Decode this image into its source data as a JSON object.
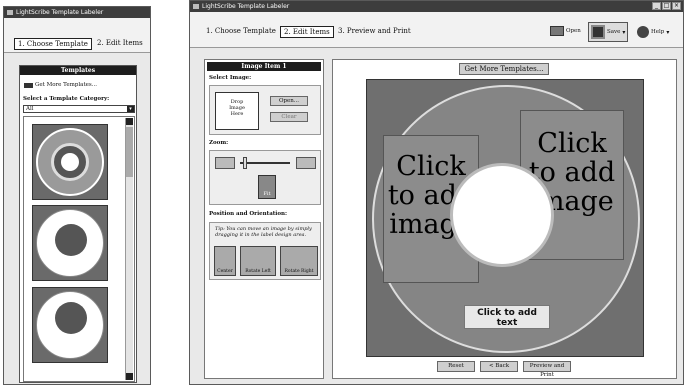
{
  "app_title": "LightScribe Template Labeler",
  "left_window": {
    "steps": [
      "1. Choose Template",
      "2. Edit Items"
    ],
    "templates_header": "Templates",
    "get_more": "Get More Templates...",
    "category_label": "Select a Template Category:",
    "category_value": "All"
  },
  "right_window": {
    "steps": [
      "1. Choose Template",
      "2. Edit Items",
      "3. Preview and Print"
    ],
    "toolbar": {
      "open": "Open",
      "save": "Save",
      "help": "Help"
    },
    "image_panel": {
      "header": "Image Item 1",
      "select_image": "Select Image:",
      "drop_text": "Drop\nImage\nHere",
      "open_btn": "Open...",
      "clear_btn": "Clear",
      "zoom_label": "Zoom:",
      "fit_btn": "Fit",
      "position_label": "Position and Orientation:",
      "tip": "Tip: You can move an image by simply dragging it in the label design area.",
      "center_btn": "Center",
      "rotate_left_btn": "Rotate Left",
      "rotate_right_btn": "Rotate Right"
    },
    "get_more_templates": "Get More Templates...",
    "canvas": {
      "left_image_text": "Click\nto add\nimage",
      "right_image_text": "Click\nto add\nimage",
      "add_text": "Click to add\ntext"
    },
    "footer": {
      "reset": "Reset",
      "back": "< Back",
      "preview": "Preview and Print"
    }
  },
  "colors": {
    "titlebar": "#3d3d3d",
    "panel_header": "#1d1d1d",
    "canvas_bg": "#6f6f6f"
  }
}
